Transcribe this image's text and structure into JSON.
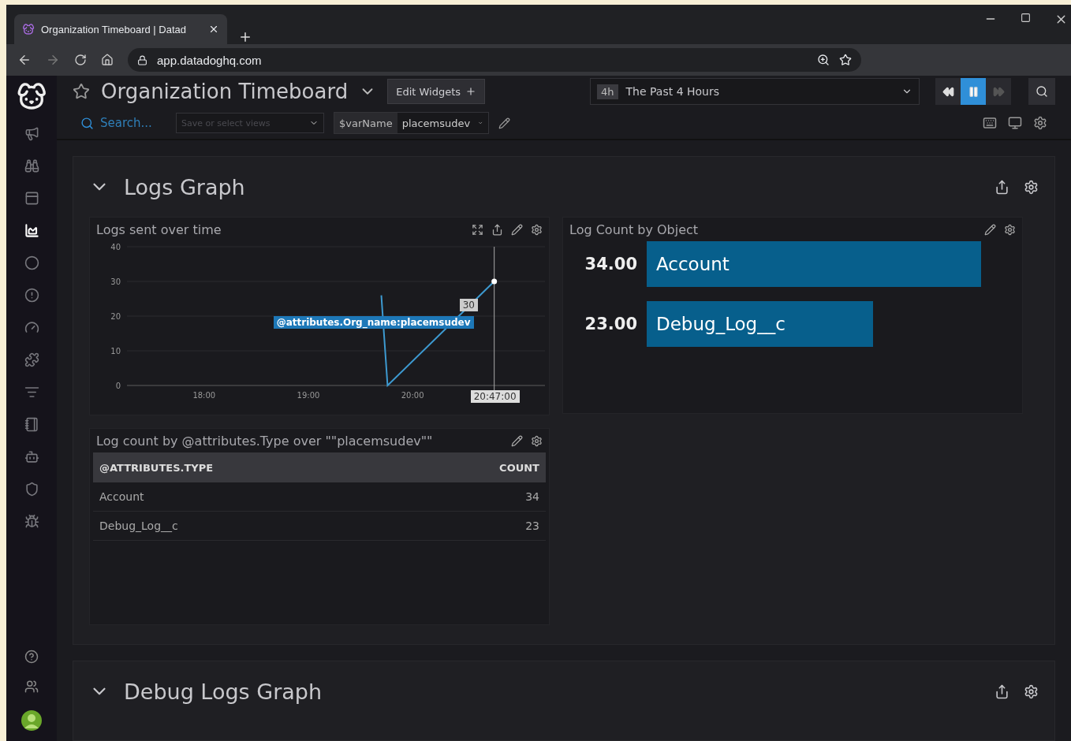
{
  "browser": {
    "tab_title": "Organization Timeboard | Datad",
    "url": "app.datadoghq.com"
  },
  "sidebar": {
    "items": [
      {
        "selected": false
      },
      {
        "selected": false
      },
      {
        "selected": false
      },
      {
        "selected": true
      },
      {
        "selected": false
      },
      {
        "selected": false
      },
      {
        "selected": false
      },
      {
        "selected": false
      },
      {
        "selected": false
      },
      {
        "selected": false
      },
      {
        "selected": false
      },
      {
        "selected": false
      },
      {
        "selected": false
      }
    ]
  },
  "header": {
    "title": "Organization Timeboard",
    "starred": false,
    "edit_button": "Edit Widgets",
    "time": {
      "badge": "4h",
      "label": "The Past 4 Hours"
    },
    "live": true
  },
  "filters": {
    "search_placeholder": "Search...",
    "views_placeholder": "Save or select views",
    "variable": {
      "name": "$varName",
      "value": "placemsudev"
    }
  },
  "groups": [
    {
      "title": "Logs Graph",
      "expanded": true,
      "widgets": [
        {
          "kind": "timeseries",
          "title": "Logs sent over time",
          "hover": {
            "value": "30",
            "time": "20:47:00"
          },
          "chart_data": {
            "type": "line",
            "grid": true,
            "ref_lines": [
              {
                "axis": "x",
                "value": 20.7833
              }
            ],
            "xlim": [
              17.26,
              21.27
            ],
            "ylim": [
              0,
              40
            ],
            "yticks": [
              0,
              10,
              20,
              30,
              40
            ],
            "xticks": [
              {
                "value": 18,
                "label": "18:00"
              },
              {
                "value": 19,
                "label": "19:00"
              },
              {
                "value": 20,
                "label": "20:00"
              }
            ],
            "series": [
              {
                "name": "@attributes.Org_name:placemsudev",
                "color": "#3d9ad1",
                "x": [
                  19.7,
                  19.76,
                  20.7833
                ],
                "values": [
                  26,
                  0,
                  30
                ]
              }
            ]
          }
        },
        {
          "kind": "toplist",
          "title": "Log Count by Object",
          "chart_data": {
            "type": "bar",
            "orientation": "horizontal",
            "categories": [
              "Account",
              "Debug_Log__c"
            ],
            "values": [
              34,
              23
            ],
            "value_labels": [
              "34.00",
              "23.00"
            ],
            "data_labels": true
          }
        },
        {
          "kind": "table",
          "title": "Log count by @attributes.Type over \"\"placemsudev\"\"",
          "columns": [
            "@ATTRIBUTES.TYPE",
            "COUNT"
          ],
          "rows": [
            [
              "Account",
              "34"
            ],
            [
              "Debug_Log__c",
              "23"
            ]
          ]
        }
      ]
    },
    {
      "title": "Debug Logs Graph",
      "expanded": true
    }
  ]
}
